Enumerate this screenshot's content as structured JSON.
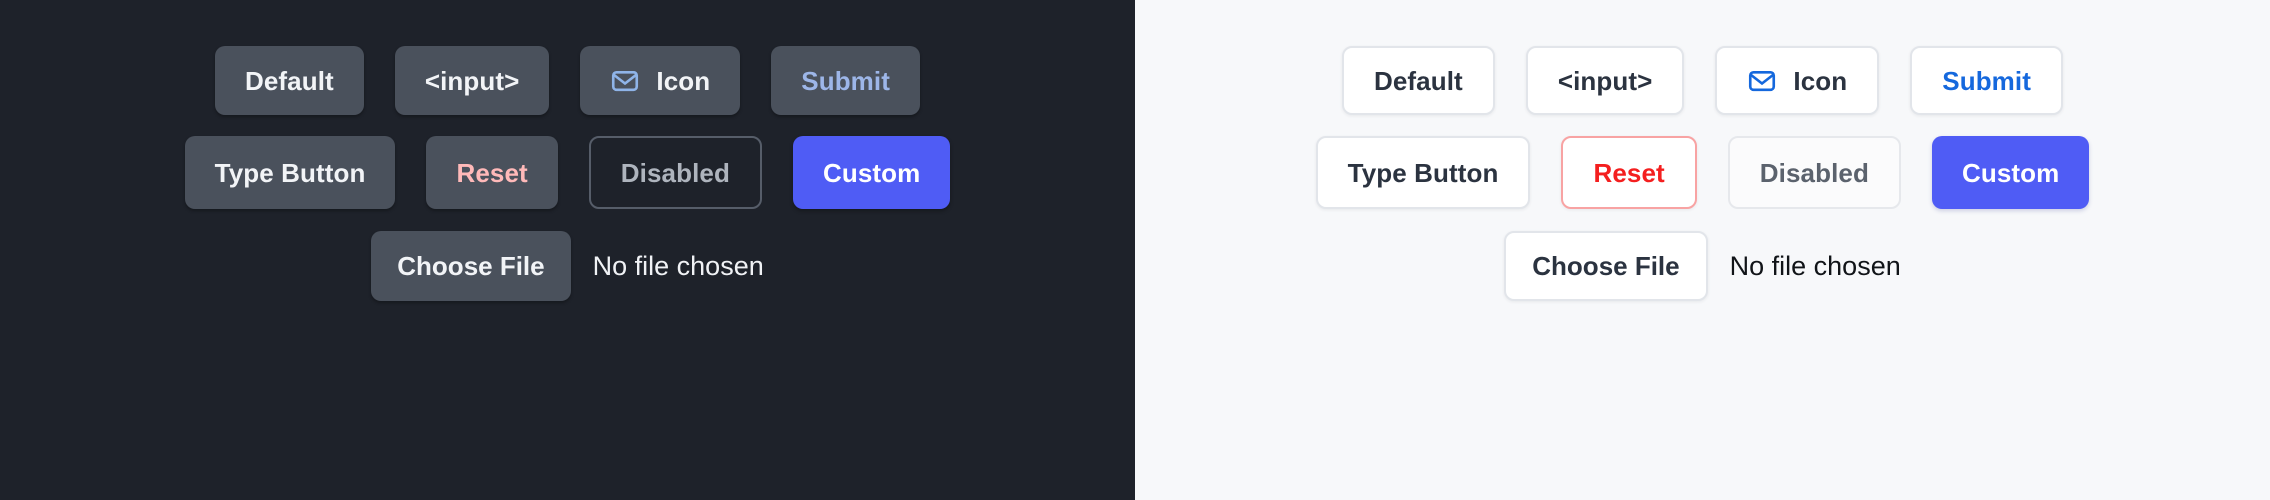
{
  "panels": [
    {
      "theme": "dark",
      "background": "#1e222a",
      "rows": [
        {
          "buttons": [
            {
              "label": "Default",
              "variant": "default"
            },
            {
              "label": "<input>",
              "variant": "input"
            },
            {
              "label": "Icon",
              "variant": "icon",
              "icon": "envelope-icon",
              "icon_color": "#8fb4e8"
            },
            {
              "label": "Submit",
              "variant": "submit",
              "text_color": "#9db6e8"
            }
          ]
        },
        {
          "buttons": [
            {
              "label": "Type Button",
              "variant": "type"
            },
            {
              "label": "Reset",
              "variant": "reset",
              "text_color": "#ffb9b9"
            },
            {
              "label": "Disabled",
              "variant": "disabled",
              "text_color": "#aeb4bd"
            },
            {
              "label": "Custom",
              "variant": "custom",
              "background": "#4f5cf5",
              "text_color": "#ffffff"
            }
          ]
        }
      ],
      "file_input": {
        "button_label": "Choose File",
        "status_text": "No file chosen"
      }
    },
    {
      "theme": "light",
      "background": "#f7f8fa",
      "rows": [
        {
          "buttons": [
            {
              "label": "Default",
              "variant": "default"
            },
            {
              "label": "<input>",
              "variant": "input"
            },
            {
              "label": "Icon",
              "variant": "icon",
              "icon": "envelope-icon",
              "icon_color": "#1568dd"
            },
            {
              "label": "Submit",
              "variant": "submit",
              "text_color": "#1568dd"
            }
          ]
        },
        {
          "buttons": [
            {
              "label": "Type Button",
              "variant": "type"
            },
            {
              "label": "Reset",
              "variant": "reset",
              "text_color": "#f41f1f",
              "border_color": "#f8a3a3"
            },
            {
              "label": "Disabled",
              "variant": "disabled",
              "text_color": "#5b626d"
            },
            {
              "label": "Custom",
              "variant": "custom",
              "background": "#4f5cf5",
              "text_color": "#ffffff"
            }
          ]
        }
      ],
      "file_input": {
        "button_label": "Choose File",
        "status_text": "No file chosen"
      }
    }
  ]
}
